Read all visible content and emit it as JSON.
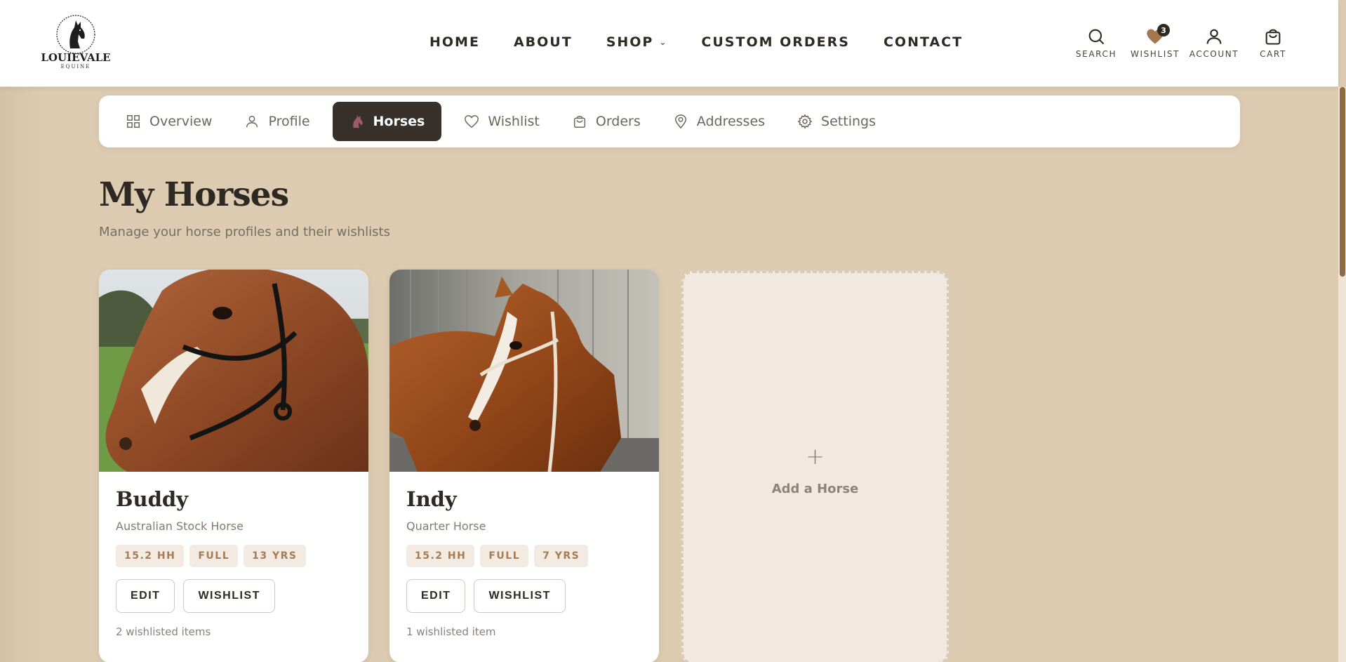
{
  "brand": {
    "name": "LOUIEVALE",
    "sub": "EQUINE"
  },
  "nav": {
    "items": [
      {
        "label": "HOME"
      },
      {
        "label": "ABOUT"
      },
      {
        "label": "SHOP",
        "dropdown": true
      },
      {
        "label": "CUSTOM ORDERS"
      },
      {
        "label": "CONTACT"
      }
    ]
  },
  "header_actions": {
    "search": "SEARCH",
    "wishlist": "WISHLIST",
    "wishlist_count": "3",
    "account": "ACCOUNT",
    "cart": "CART"
  },
  "tabs": [
    {
      "label": "Overview",
      "icon": "grid-icon"
    },
    {
      "label": "Profile",
      "icon": "user-icon"
    },
    {
      "label": "Horses",
      "icon": "horse-icon",
      "active": true
    },
    {
      "label": "Wishlist",
      "icon": "heart-icon"
    },
    {
      "label": "Orders",
      "icon": "bag-icon"
    },
    {
      "label": "Addresses",
      "icon": "map-pin-icon"
    },
    {
      "label": "Settings",
      "icon": "gear-icon"
    }
  ],
  "page": {
    "title": "My Horses",
    "subtitle": "Manage your horse profiles and their wishlists"
  },
  "horses": [
    {
      "name": "Buddy",
      "breed": "Australian Stock Horse",
      "chips": [
        "15.2 HH",
        "FULL",
        "13 YRS"
      ],
      "edit_label": "EDIT",
      "wishlist_label": "WISHLIST",
      "wishlist_count": "2 wishlisted items"
    },
    {
      "name": "Indy",
      "breed": "Quarter Horse",
      "chips": [
        "15.2 HH",
        "FULL",
        "7 YRS"
      ],
      "edit_label": "EDIT",
      "wishlist_label": "WISHLIST",
      "wishlist_count": "1 wishlisted item"
    }
  ],
  "add_horse": {
    "plus": "+",
    "label": "Add a Horse"
  },
  "colors": {
    "page_bg": "#dccbb0",
    "dark": "#38302a",
    "chip_bg": "#f3ebe1",
    "chip_text": "#a77b53",
    "accent": "#8b6a45"
  }
}
